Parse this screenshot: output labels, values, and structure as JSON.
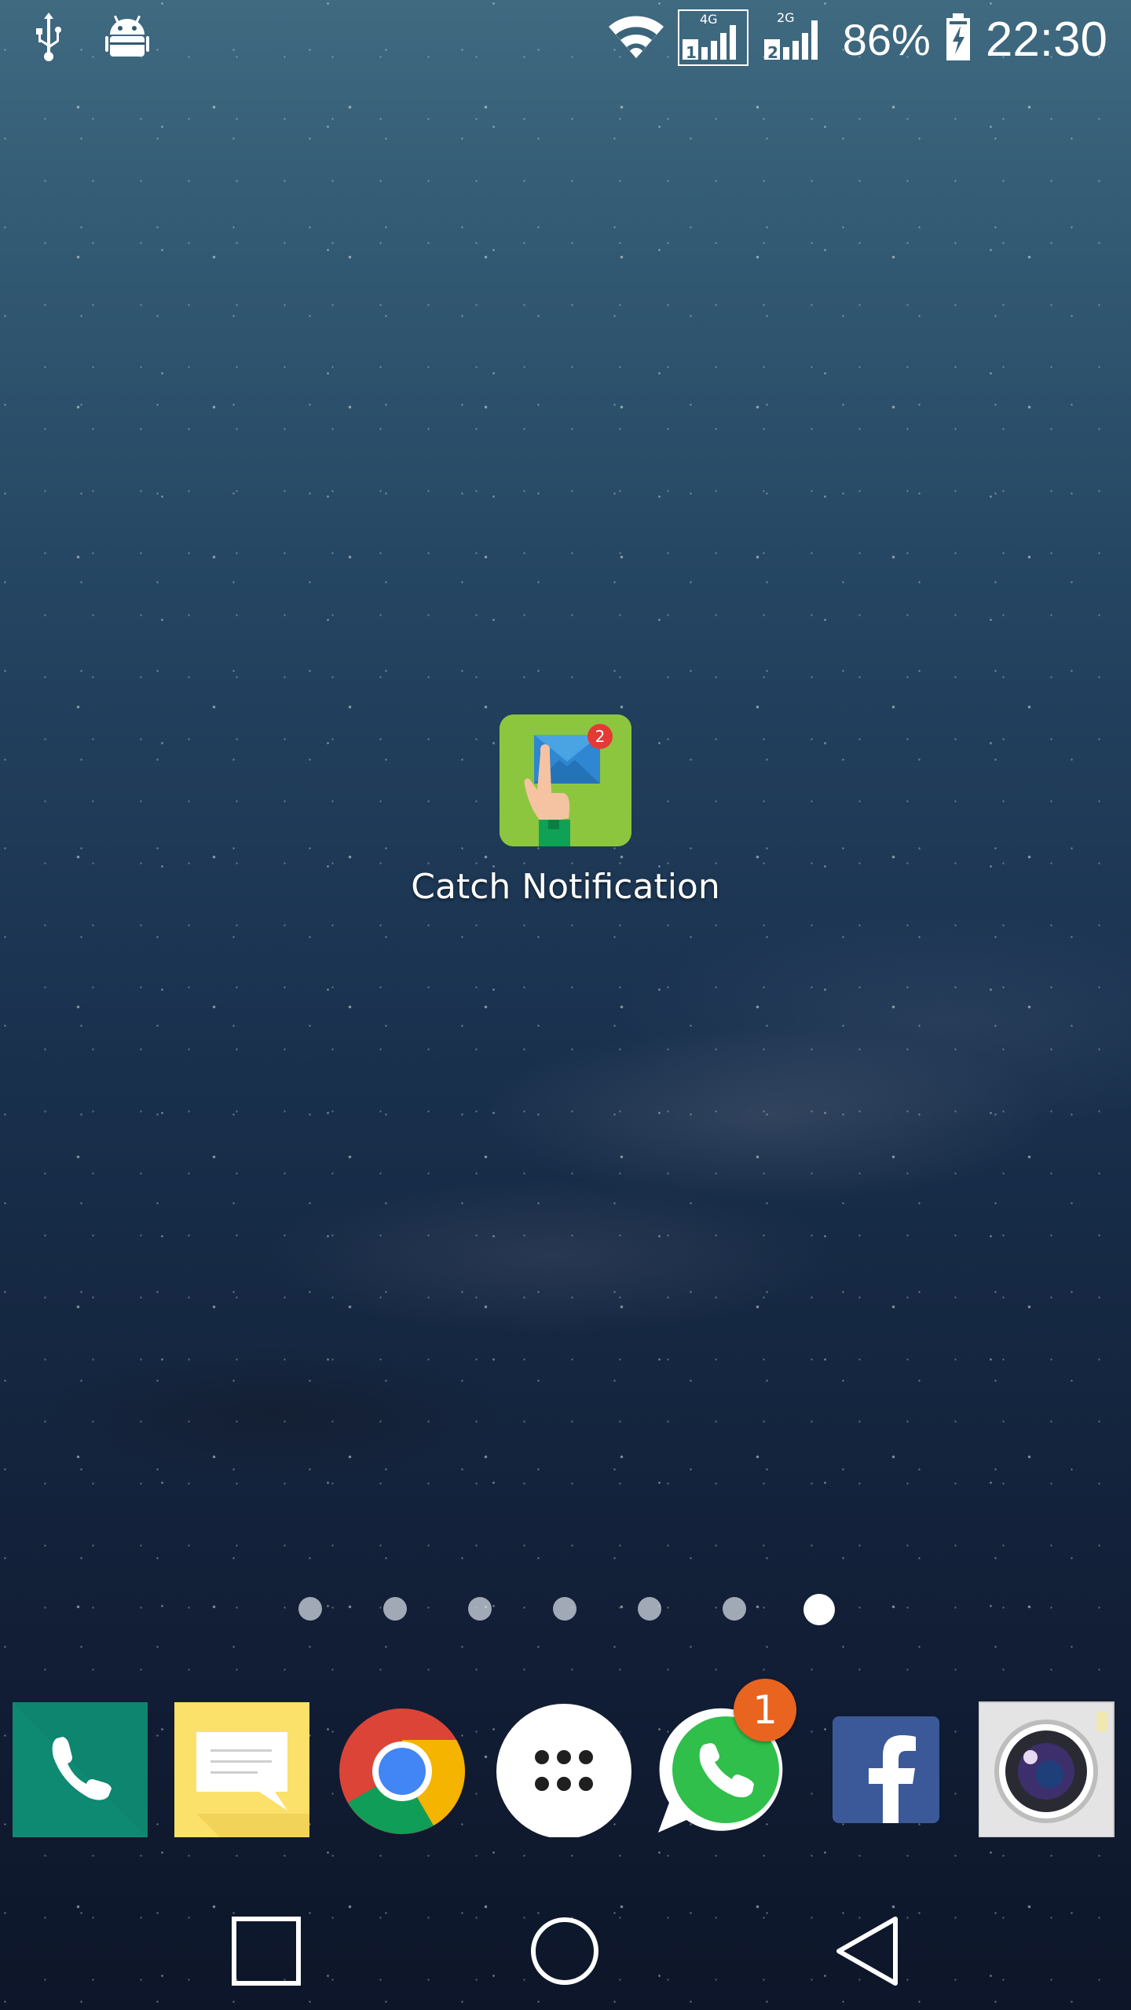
{
  "status_bar": {
    "left_icons": [
      "usb-icon",
      "android-debug-icon"
    ],
    "right_icons": [
      "wifi-icon",
      "signal-4g-sim1-icon",
      "signal-2g-sim2-icon",
      "battery-charging-icon"
    ],
    "network_sim1": "4G",
    "sim1_number": "1",
    "network_sim2": "2G",
    "sim2_number": "2",
    "battery": "86%",
    "time": "22:30"
  },
  "home": {
    "app": {
      "name": "Catch Notification",
      "badge": "2",
      "icon": "envelope-tap-icon",
      "color": "#8cc63f"
    },
    "pages": {
      "count": 7,
      "active": 7
    }
  },
  "dock": {
    "items": [
      {
        "name": "Phone",
        "icon": "phone-icon",
        "color": "#0f8a72"
      },
      {
        "name": "Messaging",
        "icon": "message-icon",
        "color": "#fbe06a"
      },
      {
        "name": "Chrome",
        "icon": "chrome-icon"
      },
      {
        "name": "Apps",
        "icon": "app-drawer-icon"
      },
      {
        "name": "WhatsApp",
        "icon": "whatsapp-icon",
        "badge": "1",
        "color": "#2fbf4a"
      },
      {
        "name": "Facebook",
        "icon": "facebook-icon",
        "color": "#3b5998"
      },
      {
        "name": "Camera",
        "icon": "camera-icon"
      }
    ]
  },
  "nav_bar": {
    "buttons": [
      "recents-icon",
      "home-icon",
      "back-icon"
    ]
  }
}
